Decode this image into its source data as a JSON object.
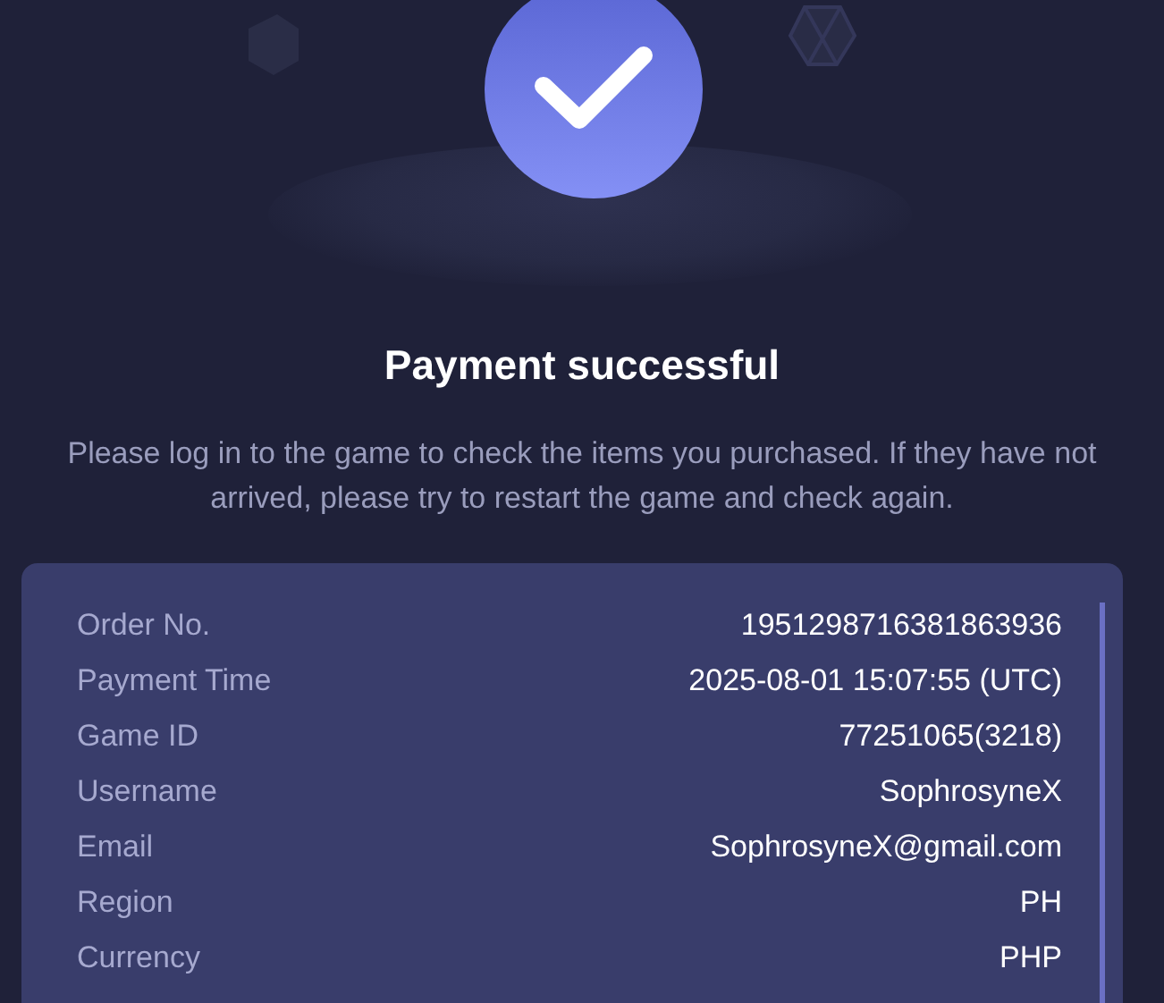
{
  "title": "Payment successful",
  "message": "Please log in to the game to check the items you purchased. If they have not arrived, please try to restart the game and check again.",
  "details": [
    {
      "label": "Order No.",
      "value": "1951298716381863936"
    },
    {
      "label": "Payment Time",
      "value": "2025-08-01 15:07:55 (UTC)"
    },
    {
      "label": "Game ID",
      "value": "77251065(3218)"
    },
    {
      "label": "Username",
      "value": "SophrosyneX"
    },
    {
      "label": "Email",
      "value": "SophrosyneX@gmail.com"
    },
    {
      "label": "Region",
      "value": "PH"
    },
    {
      "label": "Currency",
      "value": "PHP"
    }
  ]
}
